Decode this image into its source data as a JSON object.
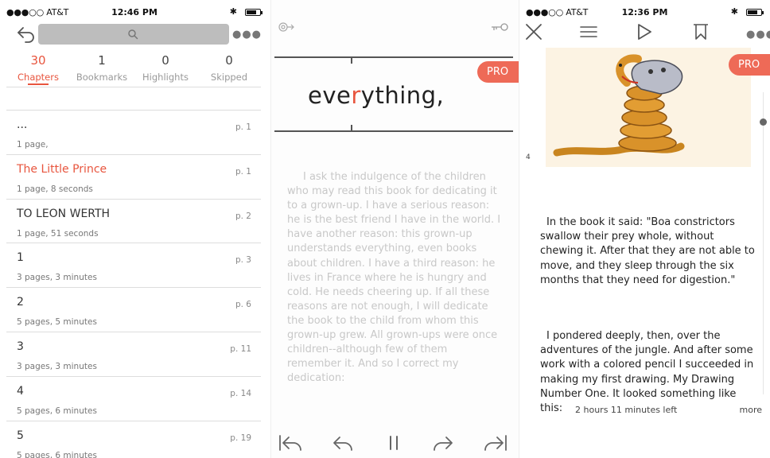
{
  "toc_screen": {
    "status": {
      "carrier": "●●●○○ AT&T",
      "time": "12:46 PM"
    },
    "tabs": [
      {
        "count": "30",
        "label": "Chapters"
      },
      {
        "count": "1",
        "label": "Bookmarks"
      },
      {
        "count": "0",
        "label": "Highlights"
      },
      {
        "count": "0",
        "label": "Skipped"
      }
    ],
    "chapters": [
      {
        "title": "...",
        "page": "p. 1",
        "meta": "1 page,"
      },
      {
        "title": "The Little Prince",
        "page": "p. 1",
        "meta": "1 page, 8 seconds"
      },
      {
        "title": "TO LEON WERTH",
        "page": "p. 2",
        "meta": "1 page, 51 seconds"
      },
      {
        "title": "1",
        "page": "p. 3",
        "meta": "3 pages, 3 minutes"
      },
      {
        "title": "2",
        "page": "p. 6",
        "meta": "5 pages, 5 minutes"
      },
      {
        "title": "3",
        "page": "p. 11",
        "meta": "3 pages, 3 minutes"
      },
      {
        "title": "4",
        "page": "p. 14",
        "meta": "5 pages, 6 minutes"
      },
      {
        "title": "5",
        "page": "p. 19",
        "meta": "5 pages, 6 minutes"
      }
    ],
    "accent": "#e8553e"
  },
  "speed_reader": {
    "word_before": "eve",
    "word_focus": "r",
    "word_after": "ything,",
    "pro_label": "PRO",
    "body_text": "I ask the indulgence of the children who may read this book for dedicating it to a grown-up. I have a serious reason: he is the best friend I have in the world. I have another reason: this grown-up understands everything, even books about children. I have a third reason: he lives in France where he is hungry and cold. He needs cheering up. If all these reasons are not enough, I will dedicate the book to the child from whom this grown-up grew. All grown-ups were once children--although few of them remember it. And so I correct my dedication:"
  },
  "book_reader": {
    "status": {
      "carrier": "●●●○○ AT&T",
      "time": "12:36 PM"
    },
    "pro_label": "PRO",
    "side_number": "4",
    "paragraph_1": "In the book it said: \"Boa constrictors swallow their prey whole, without chewing it. After that they are not able to move, and they sleep through the six months that they need for digestion.\"",
    "paragraph_2": "I pondered deeply, then, over the adventures of the jungle. And after some work with a colored pencil I succeeded in making my first drawing. My Drawing Number One. It looked something like this:",
    "time_left": "2 hours 11 minutes left",
    "more_label": "more"
  }
}
